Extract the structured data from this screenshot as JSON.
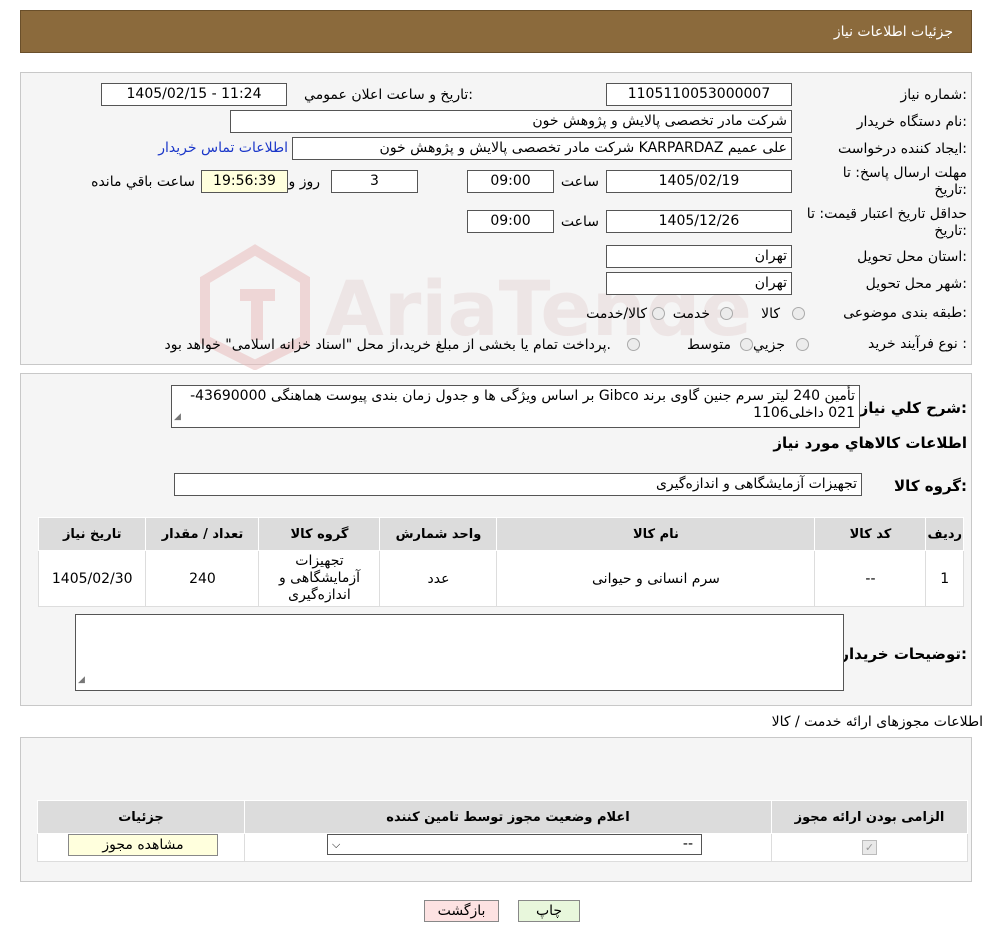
{
  "header": {
    "title": "جزئیات اطلاعات نیاز"
  },
  "details": {
    "need_number_label": "شماره نیاز:",
    "need_number": "1105110053000007",
    "announce_label": "تاریخ و ساعت اعلان عمومي:",
    "announce_value": "1405/02/15 - 11:24",
    "buyer_org_label": "نام دستگاه خریدار:",
    "buyer_org": "شرکت مادر تخصصی پالایش و پژوهش خون",
    "creator_label": "ایجاد کننده درخواست:",
    "creator": "علی عمیم KARPARDAZ شرکت مادر تخصصی پالایش و پژوهش خون",
    "contact_link": "اطلاعات تماس خریدار",
    "deadline_label_1": "مهلت ارسال پاسخ: تا",
    "deadline_label_2": "تاریخ:",
    "deadline_date": "1405/02/19",
    "time_label": "ساعت",
    "deadline_time": "09:00",
    "days_value": "3",
    "days_label": "روز و",
    "remaining_time": "19:56:39",
    "remaining_label": "ساعت باقي مانده",
    "validity_label_1": "حداقل تاریخ اعتبار قیمت: تا",
    "validity_label_2": "تاریخ:",
    "validity_date": "1405/12/26",
    "validity_time": "09:00",
    "province_label": "استان محل تحویل:",
    "province": "تهران",
    "city_label": "شهر محل تحویل:",
    "city": "تهران",
    "category_label": "طبقه بندی موضوعی:",
    "category_options": [
      "کالا",
      "خدمت",
      "کالا/خدمت"
    ],
    "process_label": "نوع فرآیند خرید :",
    "process_options": [
      "جزیي",
      "متوسط"
    ],
    "process_note": "پرداخت تمام یا بخشی از مبلغ خرید،از محل \"اسناد خزانه اسلامی\" خواهد بود."
  },
  "summary": {
    "label": "شرح کلي نیاز:",
    "text": "تأمین 240 لیتر سرم جنین گاوی برند Gibco بر اساس ویژگی ها و جدول زمان بندی پیوست هماهنگی 43690000-021 داخلی1106",
    "goods_info_title": "اطلاعات کالاهاي مورد نیاز",
    "group_label": "گروه کالا:",
    "group_value": "تجهیزات آزمایشگاهی و اندازه‌گیری",
    "columns": [
      "ردیف",
      "کد کالا",
      "نام کالا",
      "واحد شمارش",
      "گروه کالا",
      "تعداد / مقدار",
      "تاریخ نیاز"
    ],
    "rows": [
      {
        "row": "1",
        "code": "--",
        "name": "سرم انسانی و حیوانی",
        "unit": "عدد",
        "group": "تجهیزات آزمایشگاهی و اندازه‌گیری",
        "qty": "240",
        "date": "1405/02/30"
      }
    ],
    "buyer_notes_label": "توضیحات خریدار:",
    "buyer_notes": ""
  },
  "permits": {
    "title": "اطلاعات مجوزهای ارائه خدمت / کالا",
    "columns": [
      "الزامی بودن ارائه مجوز",
      "اعلام وضعیت مجوز توسط تامین کننده",
      "جزئیات"
    ],
    "select_value": "--",
    "view_button": "مشاهده مجوز"
  },
  "buttons": {
    "print": "چاپ",
    "back": "بازگشت"
  },
  "watermark": {
    "text": "AriaTender.neT"
  }
}
